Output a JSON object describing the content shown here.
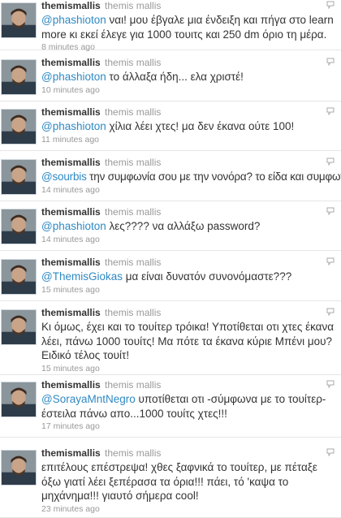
{
  "icons": {
    "avatar": "profile-photo",
    "reply": "reply-speech-bubble-icon"
  },
  "tweets": [
    {
      "screen_name": "themismallis",
      "full_name": "themis mallis",
      "mention": "@phashioton",
      "text": " ναι! μου έβγαλε μια ένδειξη και πήγα στο learn more κι εκεί έλεγε για 1000 τουιτς και 250 dm όριο τη μέρα.",
      "time": "8 minutes ago"
    },
    {
      "screen_name": "themismallis",
      "full_name": "themis mallis",
      "mention": "@phashioton",
      "text": " το άλλαξα ήδη... ελα χριστέ!",
      "time": "10 minutes ago"
    },
    {
      "screen_name": "themismallis",
      "full_name": "themis mallis",
      "mention": "@phashioton",
      "text": " χίλια λέει χτες! μα δεν έκανα ούτε 100!",
      "time": "11 minutes ago"
    },
    {
      "screen_name": "themismallis",
      "full_name": "themis mallis",
      "mention": "@sourbis",
      "text": " την συμφωνία σου με την νονόρα? το είδα και συμφωνώ!",
      "time": "14 minutes ago"
    },
    {
      "screen_name": "themismallis",
      "full_name": "themis mallis",
      "mention": "@phashioton",
      "text": " λες???? να αλλάξω password?",
      "time": "14 minutes ago"
    },
    {
      "screen_name": "themismallis",
      "full_name": "themis mallis",
      "mention": "@ThemisGiokas",
      "text": " μα είναι δυνατόν συνονόμαστε???",
      "time": "15 minutes ago"
    },
    {
      "screen_name": "themismallis",
      "full_name": "themis mallis",
      "mention": "",
      "text": "Κι όμως, έχει και το τουίτερ τρόικα! Υποτίθεται οτι χτες έκανα λέει, πάνω 1000 τουίτς! Μα πότε τα έκανα κύριε Μπένι μου? Ειδικό τέλος τουίτ!",
      "time": "15 minutes ago"
    },
    {
      "screen_name": "themismallis",
      "full_name": "themis mallis",
      "mention": "@SorayaMntNegro",
      "text": " υποτίθεται οτι -σύμφωνα με το τουίτερ- έστειλα πάνω απο...1000 τουίτς χτες!!!",
      "time": "17 minutes ago"
    },
    {
      "screen_name": "themismallis",
      "full_name": "themis mallis",
      "mention": "",
      "text": "επιτέλους επέστρεψα! χθες ξαφνικά το τουίτερ, με πέταξε όξω γιατί λέει ξεπέρασα τα όρια!!! πάει, τό 'καψα το μηχάνημα!!! γιαυτό σήμερα cool!",
      "time": "23 minutes ago"
    }
  ]
}
